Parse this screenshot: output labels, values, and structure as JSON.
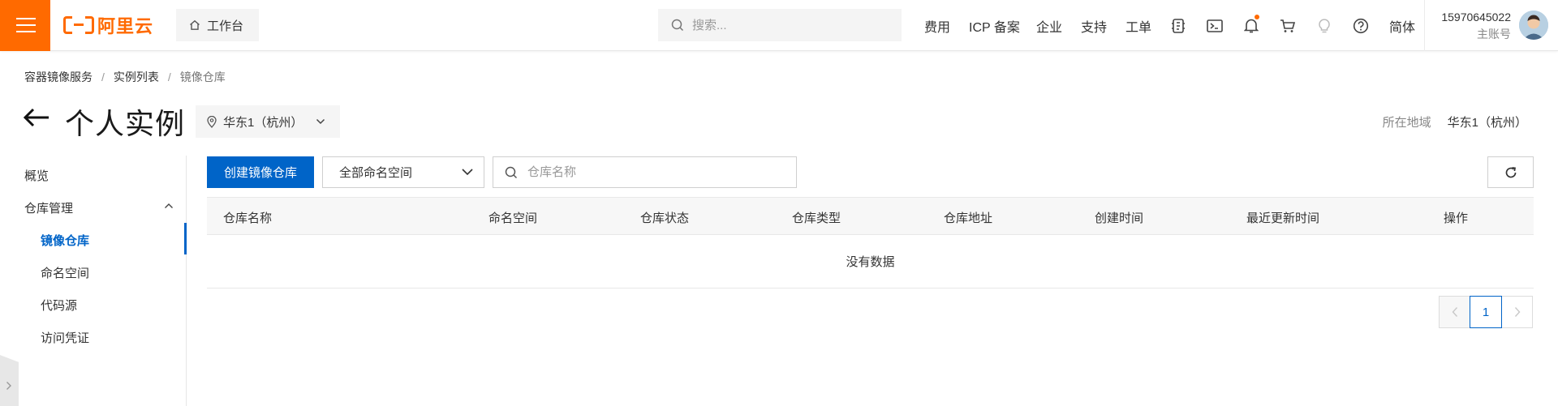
{
  "topbar": {
    "logo_text": "阿里云",
    "home_label": "工作台",
    "search_placeholder": "搜索...",
    "nav_links": [
      "费用",
      "ICP 备案",
      "企业",
      "支持",
      "工单"
    ],
    "language": "简体",
    "account_id": "15970645022",
    "account_role": "主账号",
    "accent_color": "#ff6a00",
    "icons": [
      "menu-icon",
      "home-icon",
      "search-icon",
      "app-icon",
      "terminal-icon",
      "bell-icon",
      "cart-icon",
      "lightbulb-icon",
      "help-icon"
    ]
  },
  "breadcrumb": [
    "容器镜像服务",
    "实例列表",
    "镜像仓库"
  ],
  "page": {
    "title": "个人实例",
    "region_select": "华东1（杭州）",
    "region_label": "所在地域",
    "region_value": "华东1（杭州）"
  },
  "sidebar": {
    "overview": "概览",
    "repo_mgmt": "仓库管理",
    "sub_items": [
      "镜像仓库",
      "命名空间",
      "代码源",
      "访问凭证"
    ],
    "active_item": "镜像仓库",
    "active_color": "#0064c8"
  },
  "toolbar": {
    "create_button": "创建镜像仓库",
    "namespace_select": "全部命名空间",
    "name_search_placeholder": "仓库名称"
  },
  "table": {
    "columns": [
      "仓库名称",
      "命名空间",
      "仓库状态",
      "仓库类型",
      "仓库地址",
      "创建时间",
      "最近更新时间",
      "操作"
    ],
    "empty_text": "没有数据"
  },
  "pagination": {
    "current_page": "1"
  }
}
